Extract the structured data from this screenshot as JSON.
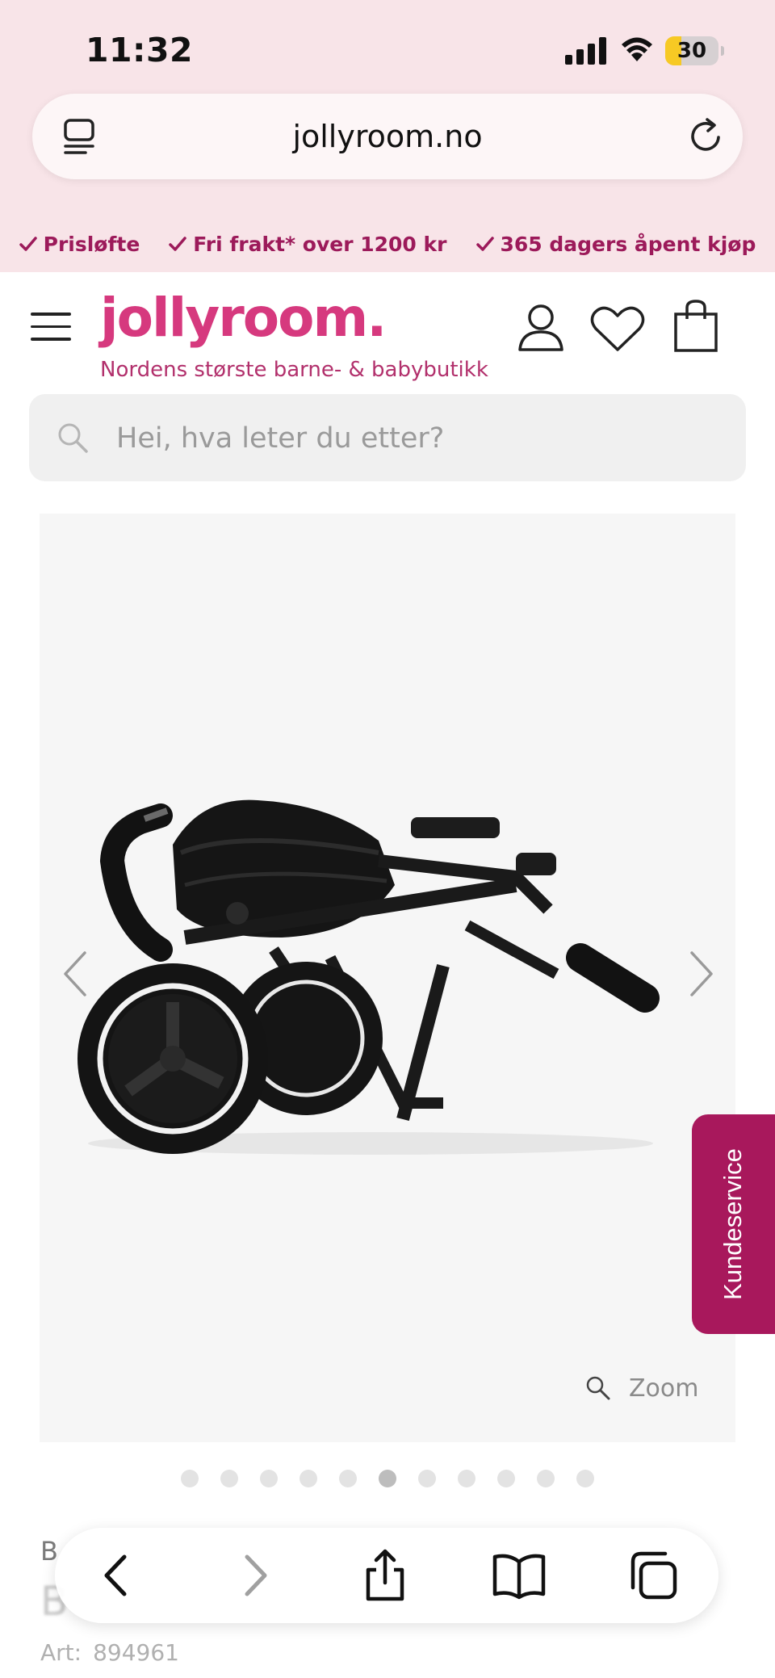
{
  "status_bar": {
    "time": "11:32",
    "battery": "30",
    "battery_level": 0.3
  },
  "browser": {
    "url": "jollyroom.no"
  },
  "usp": [
    {
      "label": "Prisløfte"
    },
    {
      "label": "Fri frakt* over 1200 kr"
    },
    {
      "label": "365 dagers åpent kjøp"
    }
  ],
  "site": {
    "logo": "jollyroom.",
    "tagline": "Nordens største barne- & babybutikk",
    "brand_color": "#d6397e"
  },
  "search": {
    "placeholder": "Hei, hva leter du etter?"
  },
  "gallery": {
    "zoom_label": "Zoom",
    "dot_count": 11,
    "active_index": 5
  },
  "customer_service": {
    "label": "Kundeservice",
    "color": "#a8185c"
  },
  "product": {
    "brand_initial": "B",
    "title_partial": "B",
    "art_label": "Art:",
    "art_number": "894961"
  }
}
